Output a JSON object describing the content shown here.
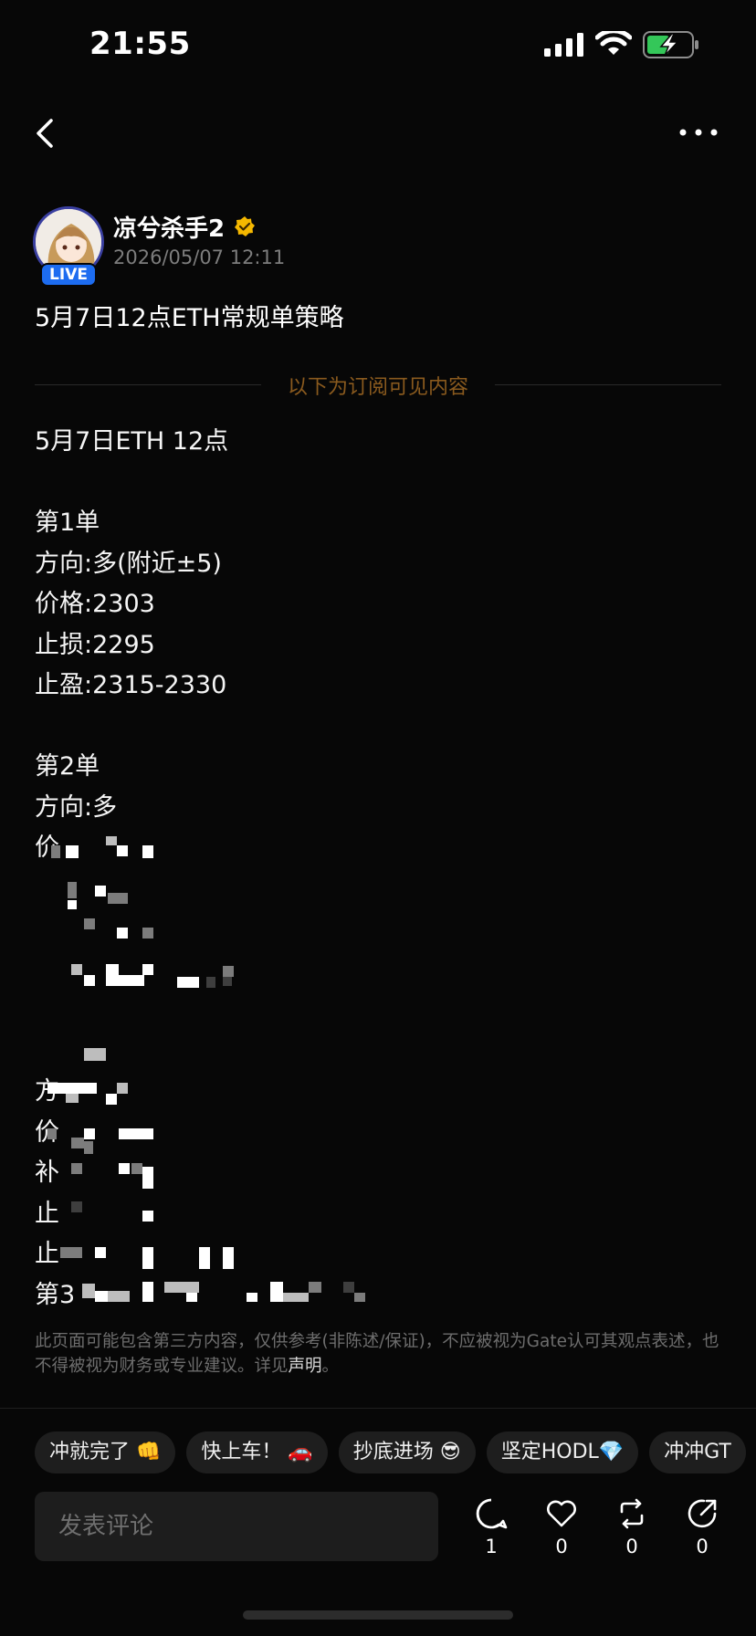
{
  "status_bar": {
    "time": "21:55"
  },
  "author": {
    "name": "凉兮杀手2",
    "timestamp": "2026/05/07 12:11",
    "live_label": "LIVE"
  },
  "post": {
    "title": "5月7日12点ETH常规单策略",
    "subscriber_divider": "以下为订阅可见内容",
    "lines": [
      "5月7日ETH 12点",
      "",
      "第1单",
      "方向:多(附近±5)",
      "价格:2303",
      "止损:2295",
      "止盈:2315-2330",
      "",
      "第2单",
      "方向:多",
      "价",
      "",
      "",
      "",
      "",
      "",
      "方",
      "价",
      "补",
      "止",
      "止",
      "第3"
    ]
  },
  "disclaimer": {
    "text": "此页面可能包含第三方内容，仅供参考(非陈述/保证)，不应被视为Gate认可其观点表述，也不得被视为财务或专业建议。详见",
    "link": "声明",
    "end": "。"
  },
  "reactions": [
    {
      "label": "冲就完了 👊"
    },
    {
      "label": "快上车！ 🚗"
    },
    {
      "label": "抄底进场 😎"
    },
    {
      "label": "坚定HODL💎"
    },
    {
      "label": "冲冲GT"
    }
  ],
  "comment": {
    "placeholder": "发表评论"
  },
  "actions": {
    "comments": "1",
    "likes": "0",
    "reposts": "0",
    "shares": "0"
  },
  "colors": {
    "background": "#070707",
    "divider_text": "#8a5a1e",
    "live_badge": "#1d6cf0",
    "verified": "#f5b800",
    "battery_fill": "#34c759"
  }
}
